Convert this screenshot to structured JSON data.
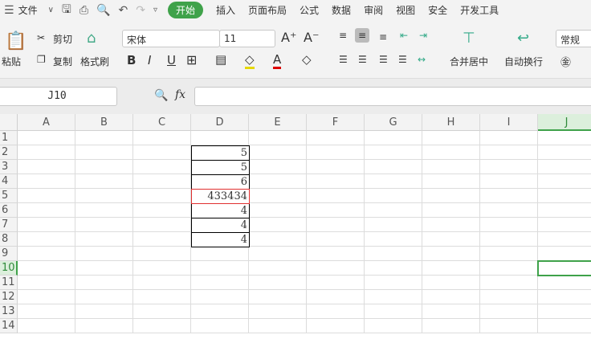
{
  "menu": {
    "file": "文件",
    "tabs": [
      "开始",
      "插入",
      "页面布局",
      "公式",
      "数据",
      "审阅",
      "视图",
      "安全",
      "开发工具"
    ]
  },
  "ribbon": {
    "paste": "粘贴",
    "cut": "剪切",
    "copy": "复制",
    "format_painter": "格式刷",
    "font": "宋体",
    "font_size": "11",
    "merge": "合并居中",
    "wrap": "自动换行",
    "number_format": "常规"
  },
  "formula_bar": {
    "name_box": "J10",
    "fx": "fx",
    "value": ""
  },
  "sheet": {
    "columns": [
      "A",
      "B",
      "C",
      "D",
      "E",
      "F",
      "G",
      "H",
      "I",
      "J"
    ],
    "rows": [
      "1",
      "2",
      "3",
      "4",
      "5",
      "6",
      "7",
      "8",
      "9",
      "10",
      "11",
      "12",
      "13",
      "14"
    ],
    "selected_cell": "J10",
    "d_values": [
      {
        "row": 2,
        "value": "5"
      },
      {
        "row": 3,
        "value": "5"
      },
      {
        "row": 4,
        "value": "6"
      },
      {
        "row": 5,
        "value": "433434"
      },
      {
        "row": 6,
        "value": "4"
      },
      {
        "row": 7,
        "value": "4"
      },
      {
        "row": 8,
        "value": "4"
      }
    ]
  },
  "colors": {
    "accent": "#3fa24a",
    "error_border": "#e03030"
  }
}
